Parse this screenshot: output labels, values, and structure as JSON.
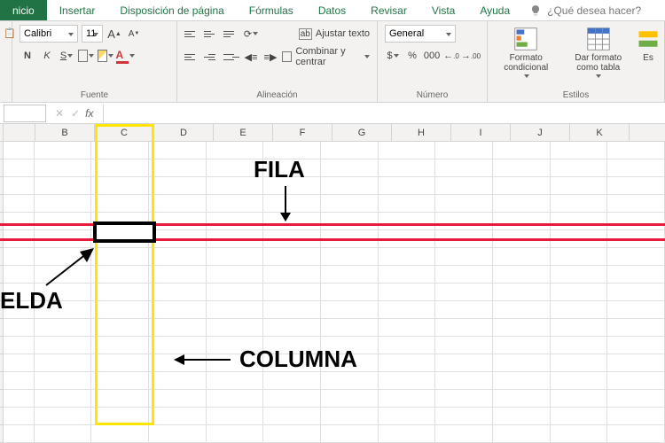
{
  "tabs": {
    "home": "nicio",
    "insert": "Insertar",
    "page_layout": "Disposición de página",
    "formulas": "Fórmulas",
    "data": "Datos",
    "review": "Revisar",
    "view": "Vista",
    "help": "Ayuda",
    "tell_me": "¿Qué desea hacer?"
  },
  "font": {
    "name": "Calibri",
    "size": "11",
    "incA": "A",
    "decA": "A",
    "bold": "N",
    "italic": "K",
    "underline": "S",
    "fill_letter": "A",
    "group_label": "Fuente"
  },
  "align": {
    "wrap": "Ajustar texto",
    "ab": "ab",
    "merge": "Combinar y centrar",
    "group_label": "Alineación"
  },
  "number": {
    "format": "General",
    "pct": "%",
    "comma": "000",
    "inc": ".0",
    "dec": ".00",
    "group_label": "Número"
  },
  "styles": {
    "cond_format": "Formato condicional",
    "table_format": "Dar formato como tabla",
    "cell_styles": "Es",
    "group_label": "Estilos"
  },
  "fx": {
    "label": "fx",
    "x": "✕",
    "check": "✓"
  },
  "columns": [
    "B",
    "C",
    "D",
    "E",
    "F",
    "G",
    "H",
    "I",
    "J",
    "K"
  ],
  "annotations": {
    "row": "FILA",
    "column": "COLUMNA",
    "cell": "ELDA"
  }
}
